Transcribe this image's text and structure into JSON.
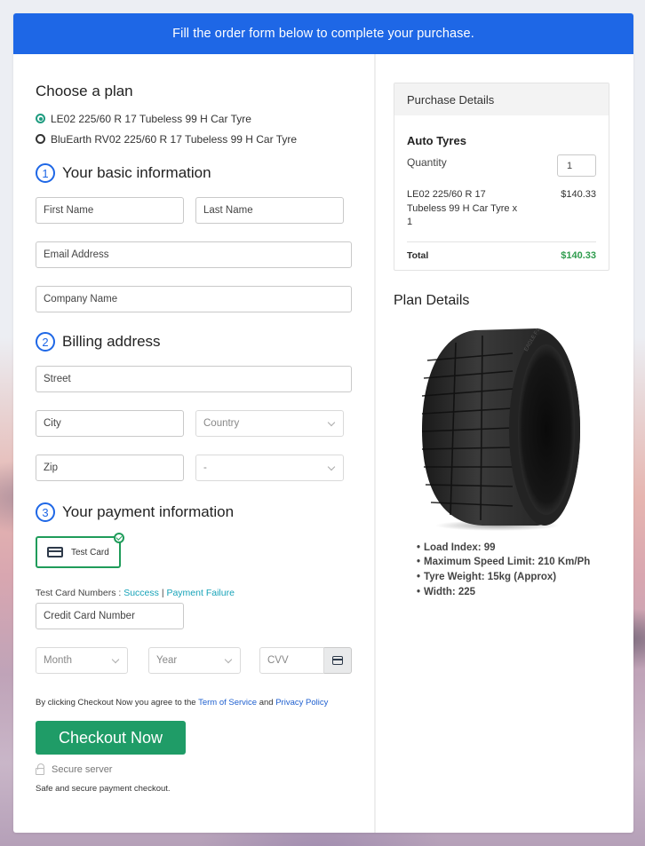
{
  "banner": {
    "text": "Fill the order form below to complete your purchase."
  },
  "plan": {
    "heading": "Choose a plan",
    "options": [
      {
        "label": "LE02 225/60 R 17 Tubeless 99 H Car Tyre",
        "selected": true
      },
      {
        "label": "BluEarth RV02 225/60 R 17 Tubeless 99 H Car Tyre",
        "selected": false
      }
    ]
  },
  "basic_info": {
    "number": "1",
    "heading": "Your basic information",
    "first_name_placeholder": "First Name",
    "last_name_placeholder": "Last Name",
    "email_placeholder": "Email Address",
    "company_placeholder": "Company Name"
  },
  "billing": {
    "number": "2",
    "heading": "Billing address",
    "street_placeholder": "Street",
    "city_placeholder": "City",
    "country_selected": "Country",
    "zip_placeholder": "Zip",
    "state_selected": "-"
  },
  "payment": {
    "number": "3",
    "heading": "Your payment information",
    "method_label": "Test Card",
    "test_numbers_label": "Test Card Numbers :",
    "success_link": "Success",
    "separator": "|",
    "failure_link": "Payment Failure",
    "card_number_placeholder": "Credit Card Number",
    "month_selected": "Month",
    "year_selected": "Year",
    "cvv_placeholder": "CVV"
  },
  "terms": {
    "prefix": "By clicking Checkout Now you agree to the",
    "tos_link": "Term of Service",
    "and": "and",
    "privacy_link": "Privacy Policy"
  },
  "checkout": {
    "button_label": "Checkout Now",
    "secure_label": "Secure server",
    "safe_text": "Safe and secure payment checkout."
  },
  "purchase_details": {
    "heading": "Purchase Details",
    "product": "Auto Tyres",
    "quantity_label": "Quantity",
    "quantity_value": "1",
    "line_item": "LE02 225/60 R 17 Tubeless 99 H Car Tyre x 1",
    "line_price": "$140.33",
    "total_label": "Total",
    "total_value": "$140.33"
  },
  "plan_details": {
    "heading": "Plan Details",
    "features": [
      "Load Index: 99",
      "Maximum Speed Limit: 210 Km/Ph",
      "Tyre Weight: 15kg (Approx)",
      "Width: 225"
    ]
  },
  "colors": {
    "brand_blue": "#1e67e6",
    "checkout_green": "#1f9c67",
    "total_green": "#2e9c4d",
    "link_teal": "#17a3b8"
  }
}
